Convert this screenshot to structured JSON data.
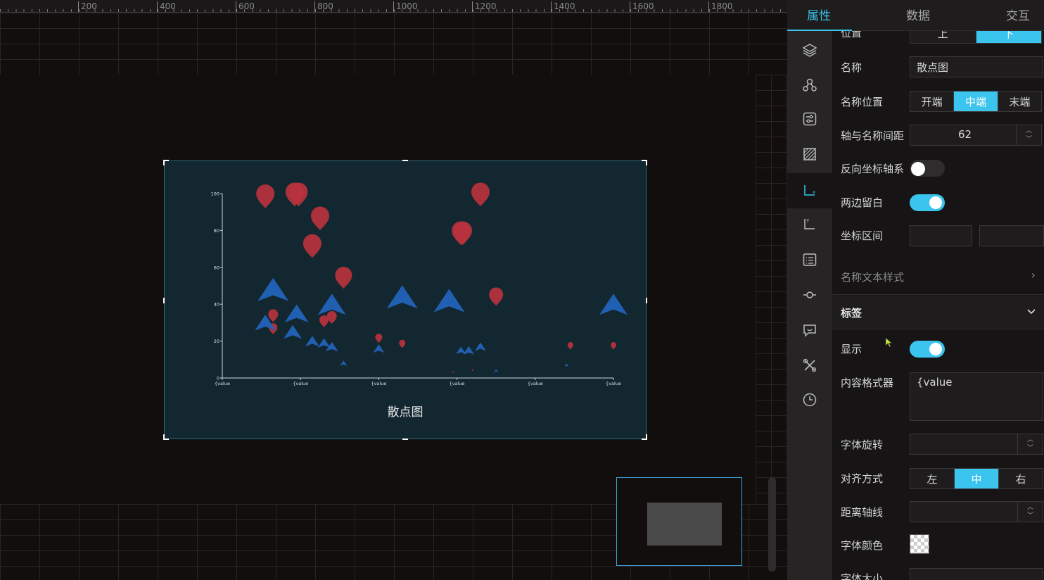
{
  "ruler": {
    "labels": [
      "200",
      "400",
      "600",
      "800",
      "1000",
      "1200",
      "1400",
      "1600",
      "1800"
    ]
  },
  "chart": {
    "title": "散点图",
    "y_ticks": [
      "100",
      "80",
      "60",
      "40",
      "20",
      "0"
    ],
    "x_ticks": [
      "{value",
      "{value",
      "{value",
      "{value",
      "{value",
      "{value"
    ]
  },
  "chart_data": {
    "type": "scatter",
    "title": "散点图",
    "ylim": [
      0,
      100
    ],
    "y_ticks": [
      0,
      20,
      40,
      60,
      80,
      100
    ],
    "x_tick_labels": [
      "{value",
      "{value",
      "{value",
      "{value",
      "{value",
      "{value"
    ],
    "xlim": [
      0,
      10
    ],
    "series": [
      {
        "symbol": "pin",
        "color": "#b8323e",
        "points": [
          [
            1.1,
            97,
            26
          ],
          [
            1.85,
            98,
            26
          ],
          [
            1.95,
            98,
            26
          ],
          [
            2.5,
            85,
            26
          ],
          [
            2.3,
            70,
            26
          ],
          [
            3.1,
            53,
            24
          ],
          [
            1.3,
            33,
            14
          ],
          [
            1.3,
            26,
            12
          ],
          [
            2.6,
            30,
            13
          ],
          [
            2.8,
            32,
            14
          ],
          [
            4.0,
            21,
            10
          ],
          [
            4.6,
            18,
            9
          ],
          [
            6.1,
            77,
            26
          ],
          [
            6.15,
            77,
            26
          ],
          [
            6.6,
            98,
            26
          ],
          [
            7.0,
            43,
            20
          ],
          [
            8.9,
            17,
            8
          ],
          [
            10.0,
            17,
            8
          ],
          [
            5.9,
            3,
            2
          ],
          [
            6.4,
            4,
            2
          ]
        ]
      },
      {
        "symbol": "triangle",
        "color": "#2162b8",
        "points": [
          [
            1.3,
            48,
            44
          ],
          [
            1.1,
            30,
            30
          ],
          [
            1.9,
            35,
            34
          ],
          [
            1.8,
            25,
            26
          ],
          [
            2.3,
            20,
            20
          ],
          [
            2.6,
            19,
            18
          ],
          [
            2.8,
            17,
            18
          ],
          [
            2.8,
            40,
            40
          ],
          [
            3.1,
            8,
            10
          ],
          [
            4.0,
            16,
            16
          ],
          [
            4.6,
            44,
            44
          ],
          [
            5.8,
            42,
            44
          ],
          [
            6.1,
            15,
            14
          ],
          [
            6.3,
            15,
            16
          ],
          [
            6.6,
            17,
            16
          ],
          [
            7.0,
            4,
            6
          ],
          [
            8.8,
            7,
            6
          ],
          [
            10.0,
            40,
            40
          ]
        ]
      }
    ]
  },
  "panel": {
    "tabs": [
      "属性",
      "数据",
      "交互"
    ],
    "icons": [
      "layers-icon",
      "nodes-icon",
      "sliders-icon",
      "hatch-icon",
      "x-axis-icon",
      "y-axis-icon",
      "list-icon",
      "marker-line-icon",
      "chat-icon",
      "tools-icon",
      "clock-icon"
    ],
    "position": {
      "label": "位置",
      "options": [
        "上",
        "下"
      ],
      "selected": 1
    },
    "name": {
      "label": "名称",
      "value": "散点图"
    },
    "name_position": {
      "label": "名称位置",
      "options": [
        "开端",
        "中端",
        "末端"
      ],
      "selected": 1
    },
    "name_gap": {
      "label": "轴与名称间距",
      "value": "62"
    },
    "inverse": {
      "label": "反向坐标轴系",
      "on": false
    },
    "boundary_gap": {
      "label": "两边留白",
      "on": true
    },
    "range": {
      "label": "坐标区间",
      "min": "",
      "max": ""
    },
    "name_text_style": {
      "label": "名称文本样式"
    },
    "label_section": {
      "title": "标签"
    },
    "show": {
      "label": "显示",
      "on": true
    },
    "formatter": {
      "label": "内容格式器",
      "value": "{value"
    },
    "rotate": {
      "label": "字体旋转",
      "value": ""
    },
    "align": {
      "label": "对齐方式",
      "options": [
        "左",
        "中",
        "右"
      ],
      "selected": 1
    },
    "margin": {
      "label": "距离轴线",
      "value": ""
    },
    "font_color": {
      "label": "字体颜色"
    },
    "font_size": {
      "label": "字体大小"
    }
  }
}
